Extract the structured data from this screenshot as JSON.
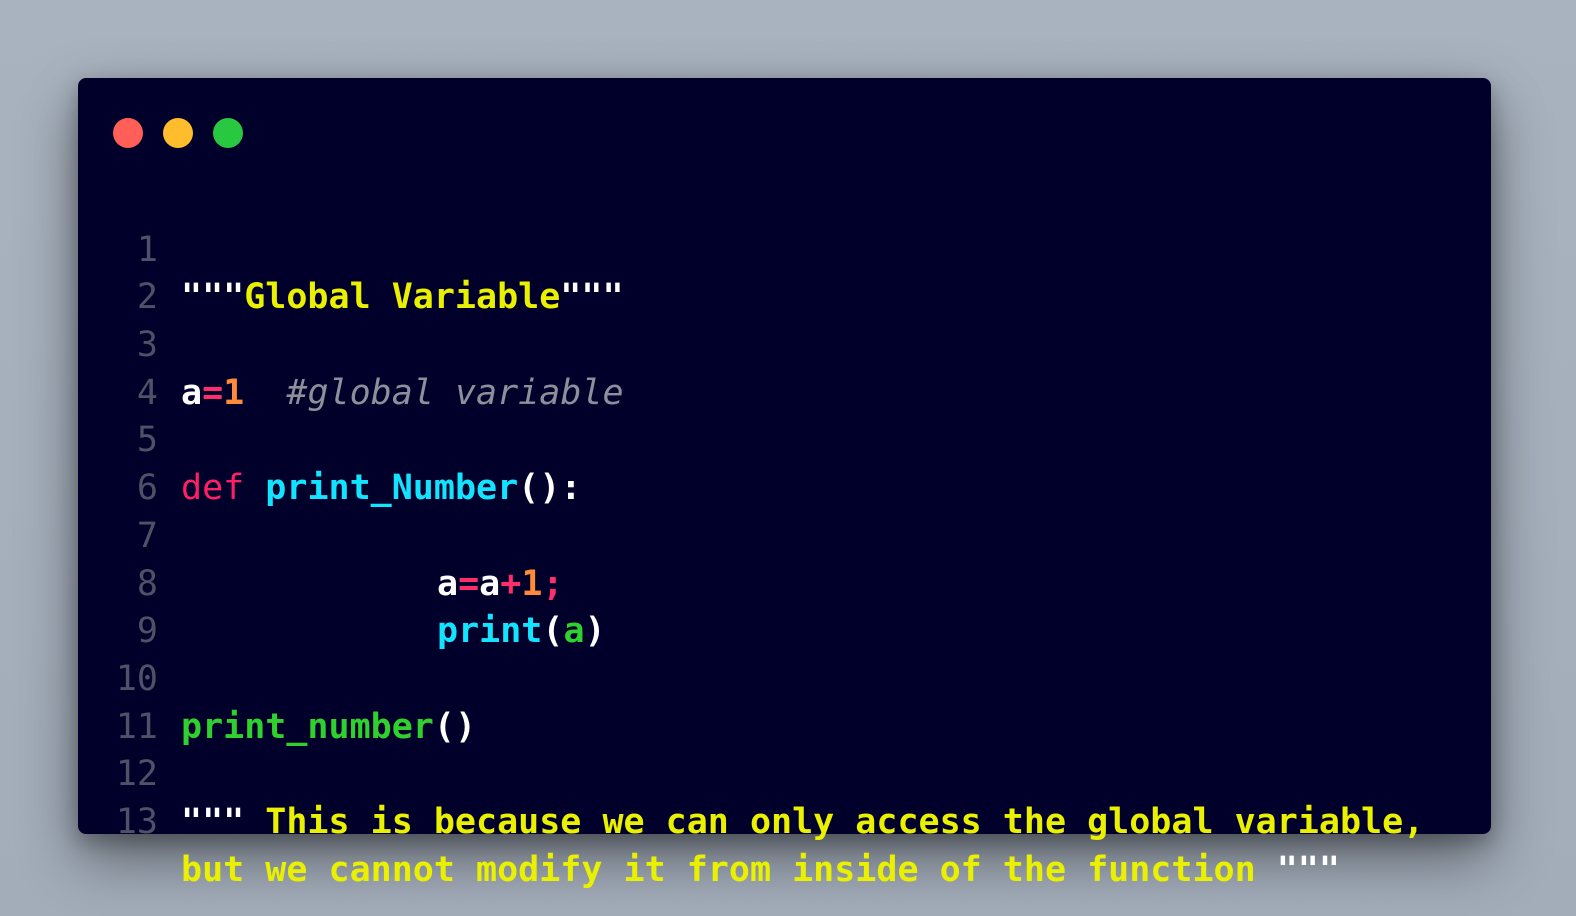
{
  "window": {
    "buttons": {
      "close_color": "#ff5f57",
      "minimize_color": "#ffbd2e",
      "maximize_color": "#28c840"
    },
    "background": "#00002b"
  },
  "code": {
    "lines": [
      {
        "number": "1"
      },
      {
        "number": "2"
      },
      {
        "number": "3"
      },
      {
        "number": "4"
      },
      {
        "number": "5"
      },
      {
        "number": "6"
      },
      {
        "number": "7"
      },
      {
        "number": "8"
      },
      {
        "number": "9"
      },
      {
        "number": "10"
      },
      {
        "number": "11"
      },
      {
        "number": "12"
      },
      {
        "number": "13"
      }
    ],
    "l1": {
      "open_quotes": "\"\"\"",
      "text": "Global Variable",
      "close_quotes": "\"\"\""
    },
    "l3": {
      "var": "a",
      "op": "=",
      "num": "1",
      "comment": "#global variable"
    },
    "l5": {
      "keyword": "def",
      "fn_name": "print_Number",
      "punc": "():"
    },
    "l7": {
      "var1": "a",
      "op1": "=",
      "var2": "a",
      "op2": "+",
      "num": "1",
      "semi": ";"
    },
    "l8": {
      "fn": "print",
      "open": "(",
      "arg": "a",
      "close": ")"
    },
    "l10": {
      "call": "print_number",
      "parens": "()"
    },
    "l12": {
      "open_quotes": "\"\"\"",
      "text": " This is because we can only access the global variable,"
    },
    "l13": {
      "text": "but we cannot modify it from inside of the function ",
      "close_quotes": "\"\"\""
    }
  }
}
